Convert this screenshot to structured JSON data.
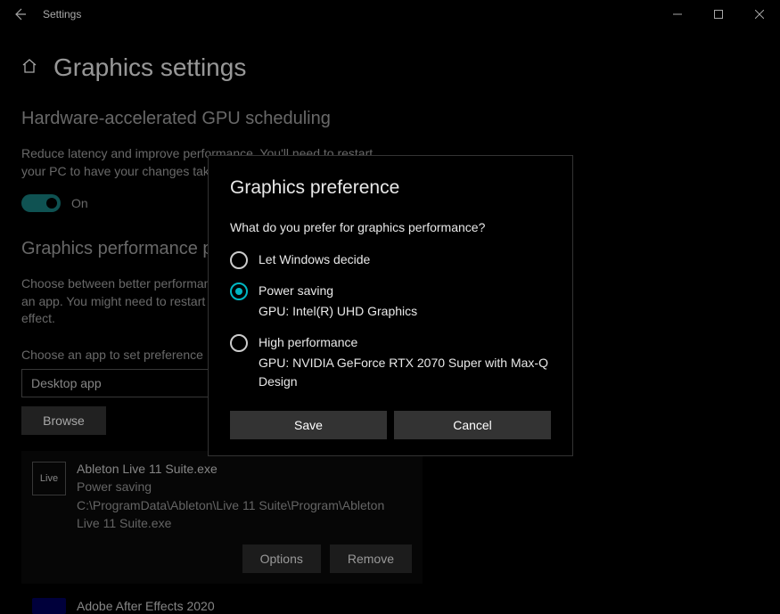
{
  "window": {
    "title": "Settings"
  },
  "page": {
    "title": "Graphics settings"
  },
  "section1": {
    "title": "Hardware-accelerated GPU scheduling",
    "desc": "Reduce latency and improve performance. You'll need to restart your PC to have your changes take effect.",
    "toggleLabel": "On"
  },
  "section2": {
    "title": "Graphics performance preference",
    "desc": "Choose between better performance or longer battery life when using an app. You might need to restart the app for your changes to take effect.",
    "selectLabel": "Choose an app to set preference",
    "selectValue": "Desktop app",
    "browse": "Browse"
  },
  "app": {
    "iconText": "Live",
    "name": "Ableton Live 11 Suite.exe",
    "pref": "Power saving",
    "path": "C:\\ProgramData\\Ableton\\Live 11 Suite\\Program\\Ableton Live 11 Suite.exe",
    "options": "Options",
    "remove": "Remove"
  },
  "nextApp": {
    "name": "Adobe After Effects 2020"
  },
  "dialog": {
    "title": "Graphics preference",
    "question": "What do you prefer for graphics performance?",
    "opt1": "Let Windows decide",
    "opt2": "Power saving",
    "opt2sub": "GPU: Intel(R) UHD Graphics",
    "opt3": "High performance",
    "opt3sub": "GPU: NVIDIA GeForce RTX 2070 Super with Max-Q Design",
    "save": "Save",
    "cancel": "Cancel"
  }
}
